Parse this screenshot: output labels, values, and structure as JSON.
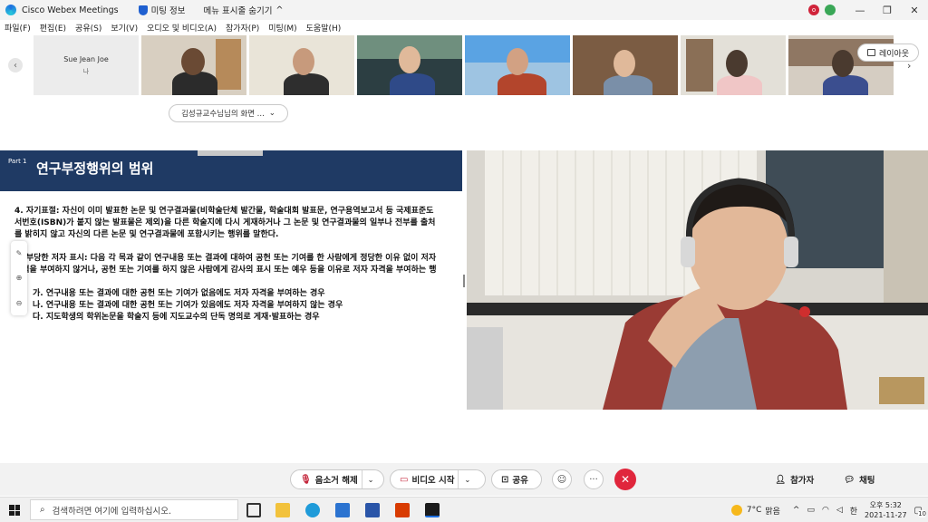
{
  "titlebar": {
    "app_name": "Cisco Webex Meetings",
    "meeting_info": "미팅 정보",
    "hide_menu": "메뉴 표시줄 숨기기",
    "hide_menu_caret": "^",
    "rec_badge": "o",
    "minimize": "—",
    "restore": "❐",
    "close": "✕"
  },
  "menubar": {
    "items": [
      "파일(F)",
      "편집(E)",
      "공유(S)",
      "보기(V)",
      "오디오 및 비디오(A)",
      "참가자(P)",
      "미팅(M)",
      "도움말(H)"
    ]
  },
  "thumbnails": {
    "first_name": "Sue Jean Joe",
    "first_sub": "나",
    "count": 8
  },
  "layout_button": {
    "label": "레이아웃"
  },
  "share_banner": {
    "label": "김성규교수님님의 화면 ...",
    "caret": "⌄"
  },
  "slide": {
    "part": "Part 1",
    "title": "연구부정행위의 범위",
    "line1": "4. 자기표절: 자신이 이미 발표한 논문 및 연구결과물(비학술단체 발간물, 학술대회 발표문, 연구용역보고서 등 국제표준도서번호(ISBN)가 붙지 않는 발표물은 제외)을 다른 학술지에 다시 게재하거나 그 논문 및 연구결과물의 일부나 전부를 출처를 밝히지 않고 자신의 다른 논문 및 연구결과물에 포함시키는 행위를 말한다.",
    "line2": "5. 부당한 저자 표시: 다음 각 목과 같이 연구내용 또는 결과에 대하여 공헌 또는 기여를 한 사람에게 정당한 이유 없이 저자 자격을 부여하지 않거나, 공헌 또는 기여를 하지 않은 사람에게 감사의 표시 또는 예우 등을 이유로 저자 자격을 부여하는 행위",
    "item_a": "가. 연구내용 또는 결과에 대한 공헌 또는 기여가 없음에도 저자 자격을 부여하는 경우",
    "item_b": "나. 연구내용 또는 결과에 대한 공헌 또는 기여가 있음에도 저자 자격을 부여하지 않는 경우",
    "item_c": "다. 지도학생의 학위논문을 학술지 등에 지도교수의 단독 명의로 게재·발표하는 경우"
  },
  "controls": {
    "mute": "음소거 해제",
    "video": "비디오 시작",
    "share": "공유",
    "participants": "참가자",
    "chat": "채팅",
    "more": "···",
    "caret": "⌄"
  },
  "taskbar": {
    "search_placeholder": "검색하려면 여기에 입력하십시오.",
    "weather_temp": "7°C",
    "weather_text": "맑음",
    "ime": "한",
    "time": "오후 5:32",
    "date": "2021-11-27",
    "notifications": "10"
  },
  "colors": {
    "slide_header": "#1f3a64",
    "end_button": "#e0263c",
    "accent_blue": "#1e5fd0"
  }
}
